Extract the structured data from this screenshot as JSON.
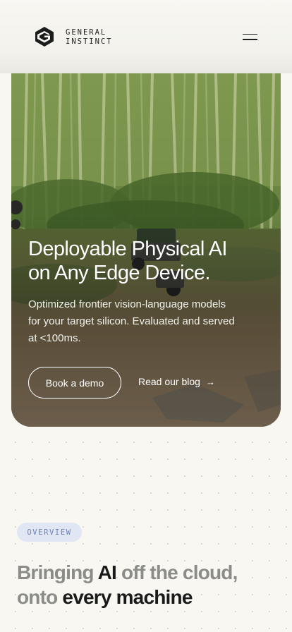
{
  "header": {
    "brand_line1": "GENERAL",
    "brand_line2": "INSTINCT",
    "logo_icon": "general-instinct-logo",
    "menu_icon": "hamburger-menu-icon"
  },
  "hero": {
    "title_line1": "Deployable Physical AI",
    "title_line2": "on Any Edge Device.",
    "subtitle_line1": "Optimized frontier vision-language models",
    "subtitle_line2": "for your target silicon. Evaluated and served",
    "subtitle_line3": "at <100ms.",
    "primary_button": "Book a demo",
    "secondary_link": "Read our blog",
    "arrow": "→"
  },
  "overview": {
    "badge": "OVERVIEW",
    "headline_a": "Bringing ",
    "headline_b": "AI",
    "headline_c": " off the cloud,",
    "headline_d": "onto ",
    "headline_e": "every machine"
  },
  "colors": {
    "background": "#f8f7f2",
    "badge_bg": "#e0e6f3",
    "badge_text": "#6e83b8",
    "muted_text": "#8b8b88",
    "strong_text": "#1a1a1a"
  }
}
